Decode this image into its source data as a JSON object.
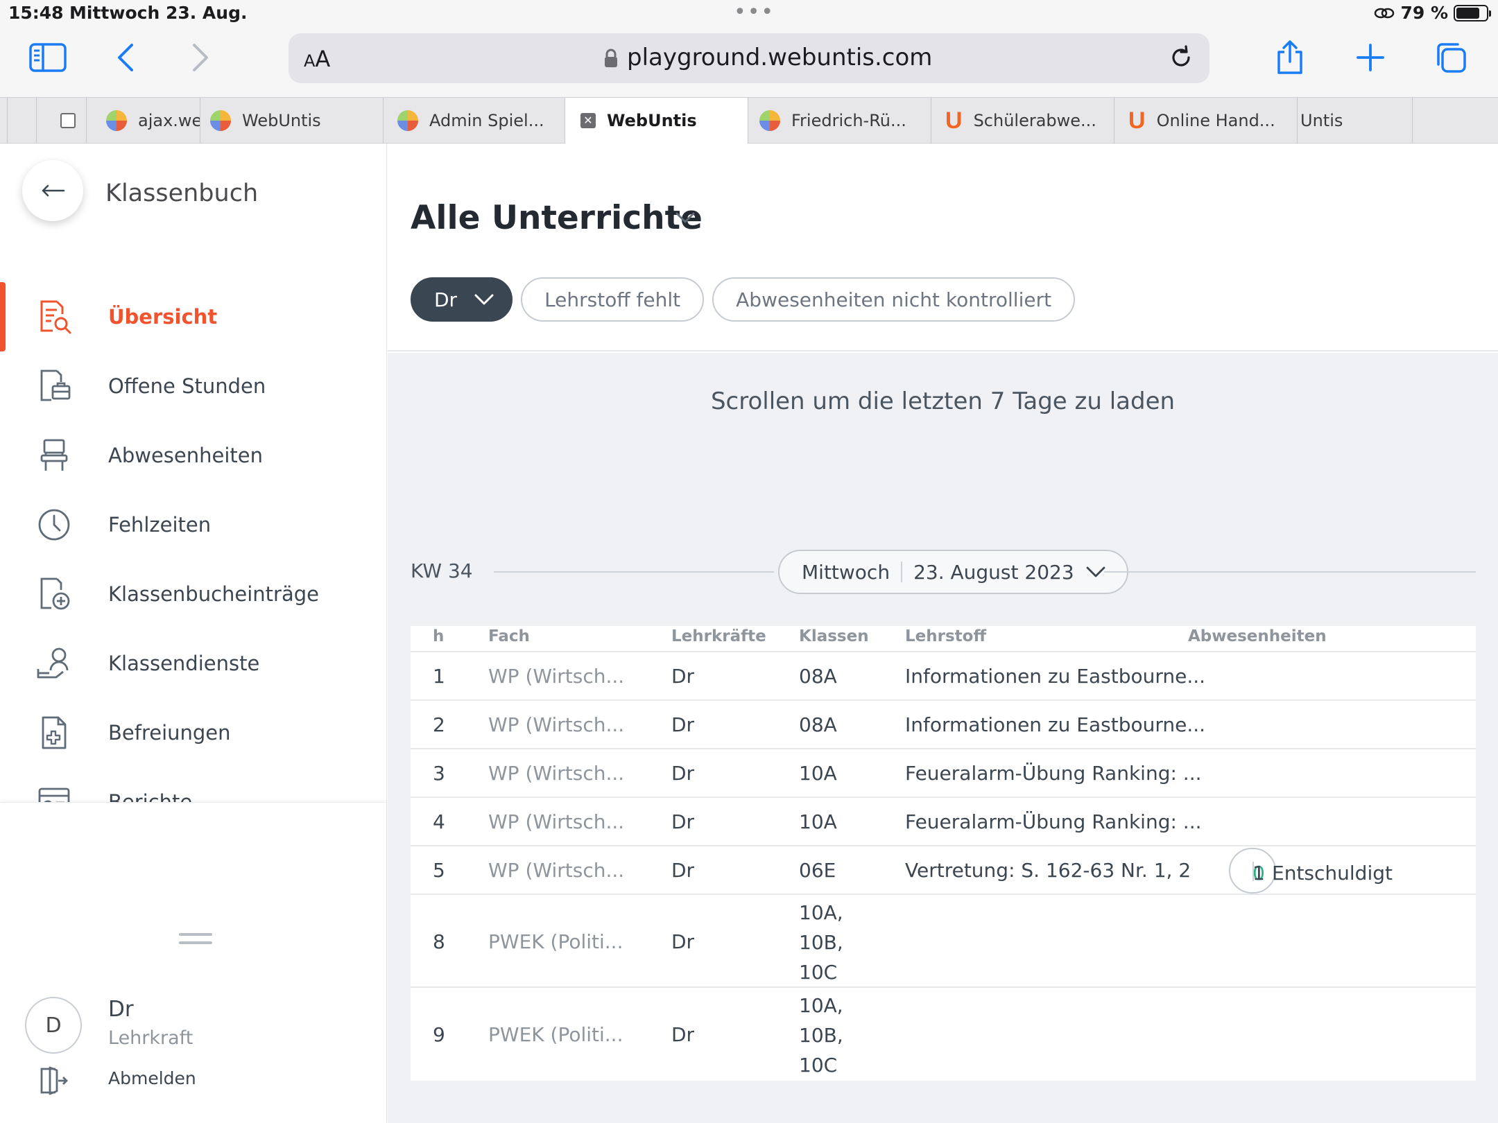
{
  "status": {
    "time": "15:48",
    "date": "Mittwoch 23. Aug.",
    "battery": "79 %",
    "battery_level": 0.79
  },
  "browser": {
    "address_aa": "AA",
    "url": "playground.webuntis.com",
    "tabs": [
      {
        "label": "ajax.we",
        "icon": "webuntis-favicon"
      },
      {
        "label": "WebUntis",
        "icon": "webuntis-favicon"
      },
      {
        "label": "Admin Spiel...",
        "icon": "webuntis-favicon"
      },
      {
        "label": "WebUntis",
        "icon": "close-icon",
        "active": true
      },
      {
        "label": "Friedrich-Rü...",
        "icon": "webuntis-favicon"
      },
      {
        "label": "Schülerabwe...",
        "icon": "untis-u-icon"
      },
      {
        "label": "Online Hand...",
        "icon": "untis-u-icon"
      },
      {
        "label": "Untis",
        "icon": ""
      }
    ]
  },
  "sidebar": {
    "title": "Klassenbuch",
    "items": [
      {
        "label": "Übersicht",
        "icon": "overview-search-icon",
        "active": true
      },
      {
        "label": "Offene Stunden",
        "icon": "open-lessons-icon"
      },
      {
        "label": "Abwesenheiten",
        "icon": "chair-icon"
      },
      {
        "label": "Fehlzeiten",
        "icon": "clock-icon"
      },
      {
        "label": "Klassenbucheinträge",
        "icon": "add-entry-icon"
      },
      {
        "label": "Klassendienste",
        "icon": "class-duty-icon"
      },
      {
        "label": "Befreiungen",
        "icon": "exemption-icon"
      },
      {
        "label": "Berichte",
        "icon": "reports-icon"
      }
    ],
    "user": {
      "initial": "D",
      "name": "Dr",
      "role": "Lehrkraft",
      "logout": "Abmelden"
    }
  },
  "main": {
    "title": "Alle Unterrichte",
    "filters": {
      "teacher": "Dr",
      "missing_topic": "Lehrstoff fehlt",
      "absences_unchecked": "Abwesenheiten nicht kontrolliert"
    },
    "scroll_hint": "Scrollen um die letzten 7 Tage zu laden",
    "week": "KW 34",
    "day": "Mittwoch",
    "date": "23. August 2023",
    "columns": {
      "h": "h",
      "fach": "Fach",
      "lehrkraefte": "Lehrkräfte",
      "klassen": "Klassen",
      "lehrstoff": "Lehrstoff",
      "abwesenheiten": "Abwesenheiten"
    },
    "rows": [
      {
        "h": "1",
        "fach": "WP (Wirtsch...",
        "lehrkraft": "Dr",
        "klassen": "08A",
        "lehrstoff": "Informationen zu Eastbourne..."
      },
      {
        "h": "2",
        "fach": "WP (Wirtsch...",
        "lehrkraft": "Dr",
        "klassen": "08A",
        "lehrstoff": "Informationen zu Eastbourne..."
      },
      {
        "h": "3",
        "fach": "WP (Wirtsch...",
        "lehrkraft": "Dr",
        "klassen": "10A",
        "lehrstoff": "Feueralarm-Übung Ranking: ..."
      },
      {
        "h": "4",
        "fach": "WP (Wirtsch...",
        "lehrkraft": "Dr",
        "klassen": "10A",
        "lehrstoff": "Feueralarm-Übung Ranking: ..."
      },
      {
        "h": "5",
        "fach": "WP (Wirtsch...",
        "lehrkraft": "Dr",
        "klassen": "06E",
        "lehrstoff": "Vertretung: S. 162-63 Nr. 1, 2",
        "abw_open": "0",
        "abw_count": "1",
        "abw_label": "Entschuldigt"
      },
      {
        "h": "8",
        "fach": "PWEK (Politi...",
        "lehrkraft": "Dr",
        "klassen": "10A,\n10B,\n10C",
        "lehrstoff": ""
      },
      {
        "h": "9",
        "fach": "PWEK (Politi...",
        "lehrkraft": "Dr",
        "klassen": "10A,\n10B,\n10C",
        "lehrstoff": ""
      }
    ]
  },
  "colors": {
    "accent": "#f0532d",
    "safari_blue": "#1a7cf5",
    "chip_dark": "#3a4652",
    "excused_green": "#2bb07f"
  }
}
